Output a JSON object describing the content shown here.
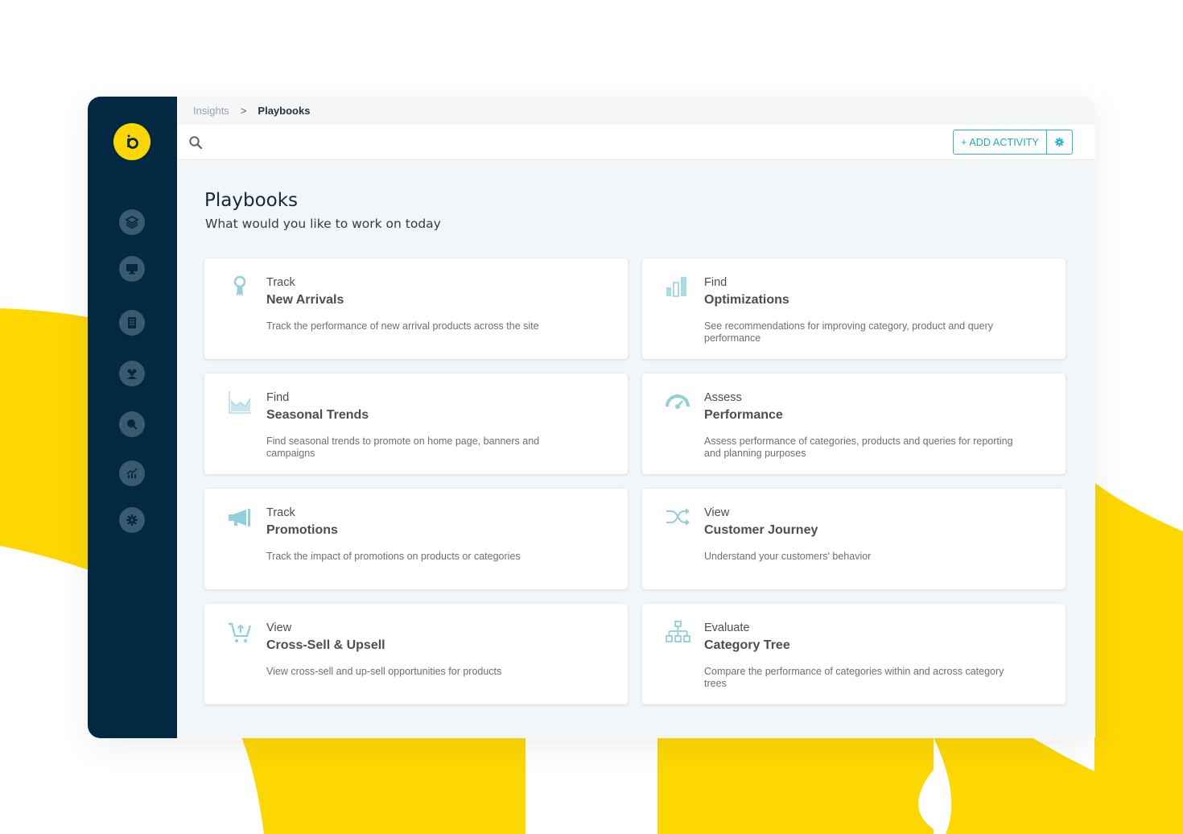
{
  "colors": {
    "brand_yellow": "#fed700",
    "sidebar_navy": "#022842",
    "accent_blue": "#1fa9cc",
    "icon_teal": "#8fd0da"
  },
  "brand": {
    "logo_icon": "brand-logo-b"
  },
  "sidebar": {
    "items": [
      {
        "icon": "layers-icon",
        "label": "Layers"
      },
      {
        "icon": "monitor-icon",
        "label": "Monitor"
      },
      {
        "icon": "document-icon",
        "label": "Documents"
      },
      {
        "icon": "users-icon",
        "label": "Users"
      },
      {
        "icon": "search-icon",
        "label": "Search"
      },
      {
        "icon": "chart-icon",
        "label": "Analytics"
      },
      {
        "icon": "settings-icon",
        "label": "Settings"
      }
    ]
  },
  "breadcrumb": {
    "items": [
      "Insights",
      "Playbooks"
    ],
    "separator": ">"
  },
  "toolbar": {
    "add_activity_label": "+ ADD ACTIVITY",
    "settings_icon": "gear-icon",
    "search_icon": "search-icon"
  },
  "page": {
    "title": "Playbooks",
    "subtitle": "What would you like to work on today"
  },
  "playbooks": [
    {
      "icon": "ribbon-award-icon",
      "verb": "Track",
      "title": "New Arrivals",
      "description": "Track the performance of new arrival products across the site"
    },
    {
      "icon": "bar-chart-icon",
      "verb": "Find",
      "title": "Optimizations",
      "description": "See recommendations for improving category, product and query performance"
    },
    {
      "icon": "area-chart-icon",
      "verb": "Find",
      "title": "Seasonal Trends",
      "description": "Find seasonal trends to promote on home page, banners and campaigns"
    },
    {
      "icon": "gauge-icon",
      "verb": "Assess",
      "title": "Performance",
      "description": "Assess performance of categories, products and queries for reporting and planning purposes"
    },
    {
      "icon": "megaphone-icon",
      "verb": "Track",
      "title": "Promotions",
      "description": "Track the impact of promotions on products or categories"
    },
    {
      "icon": "shuffle-icon",
      "verb": "View",
      "title": "Customer Journey",
      "description": "Understand your customers' behavior"
    },
    {
      "icon": "cart-upsell-icon",
      "verb": "View",
      "title": "Cross-Sell & Upsell",
      "description": "View cross-sell and up-sell opportunities for products"
    },
    {
      "icon": "hierarchy-tree-icon",
      "verb": "Evaluate",
      "title": "Category Tree",
      "description": "Compare the performance of categories within and across category trees"
    }
  ]
}
